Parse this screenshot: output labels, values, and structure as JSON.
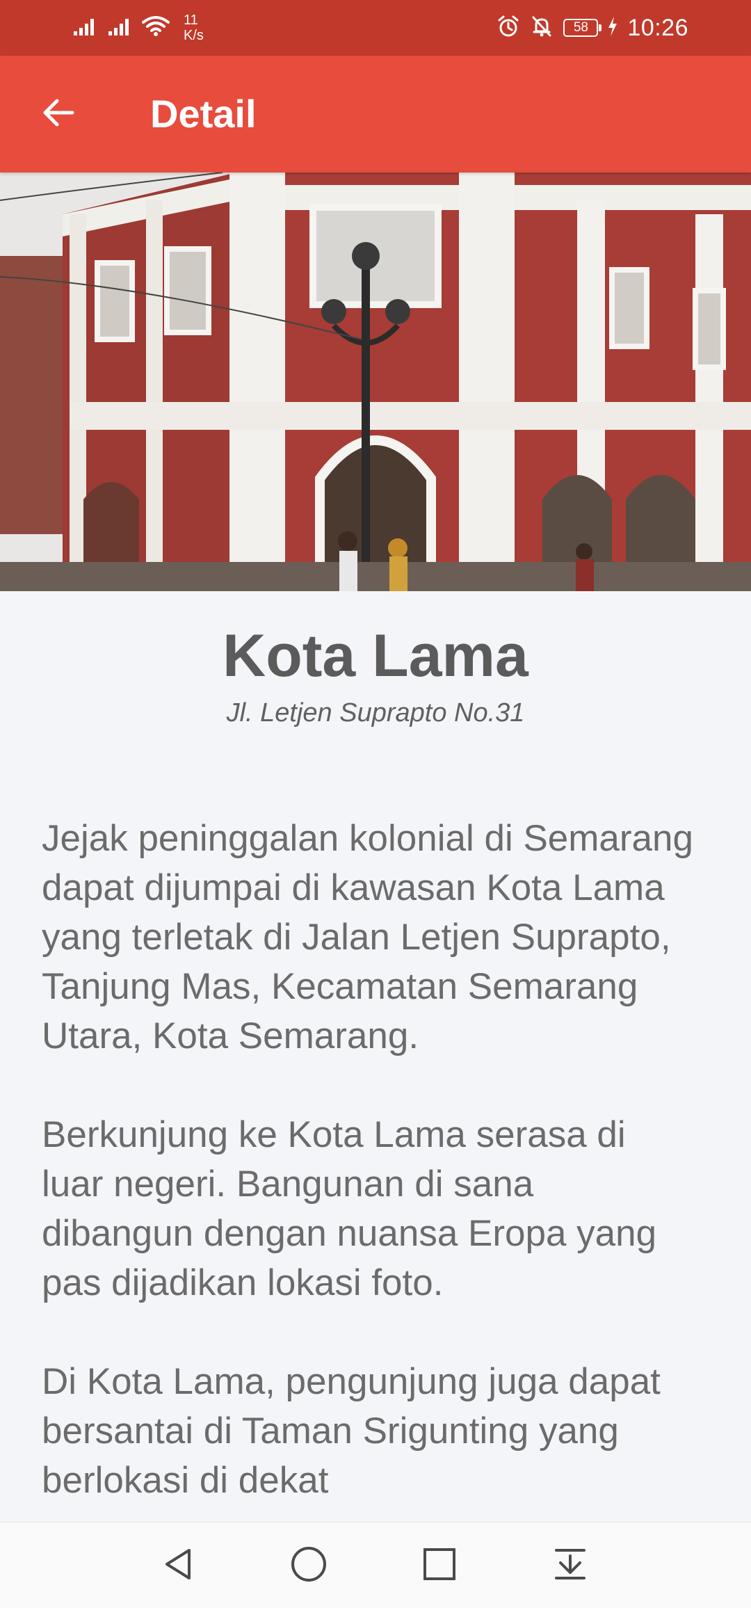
{
  "status_bar": {
    "net_speed_value": "11",
    "net_speed_unit": "K/s",
    "battery_level": "58",
    "time": "10:26"
  },
  "app_bar": {
    "title": "Detail",
    "back_icon": "arrow-left-icon",
    "background_color": "#e74c3c"
  },
  "hero_image": {
    "description": "Colonial red-and-white building with ornate street lamp"
  },
  "place": {
    "name": "Kota Lama",
    "address": "Jl. Letjen Suprapto No.31",
    "paragraphs": [
      "Jejak peninggalan kolonial di Semarang dapat dijumpai di kawasan Kota Lama yang terletak di Jalan Letjen Suprapto, Tanjung Mas, Kecamatan Semarang Utara, Kota Semarang.",
      "Berkunjung ke Kota Lama serasa di luar negeri. Bangunan di sana dibangun dengan nuansa Eropa yang pas dijadikan lokasi foto.",
      "Di Kota Lama, pengunjung juga dapat bersantai di Taman Srigunting yang berlokasi di dekat"
    ]
  },
  "nav_bar": {
    "items": [
      "back-triangle-icon",
      "home-circle-icon",
      "recents-square-icon",
      "notification-pulldown-icon"
    ]
  },
  "colors": {
    "status_bar": "#c0392b",
    "app_bar": "#e74c3c",
    "background": "#f4f5f9",
    "title_text": "#5b5b5b",
    "body_text": "#6b6b6b"
  }
}
